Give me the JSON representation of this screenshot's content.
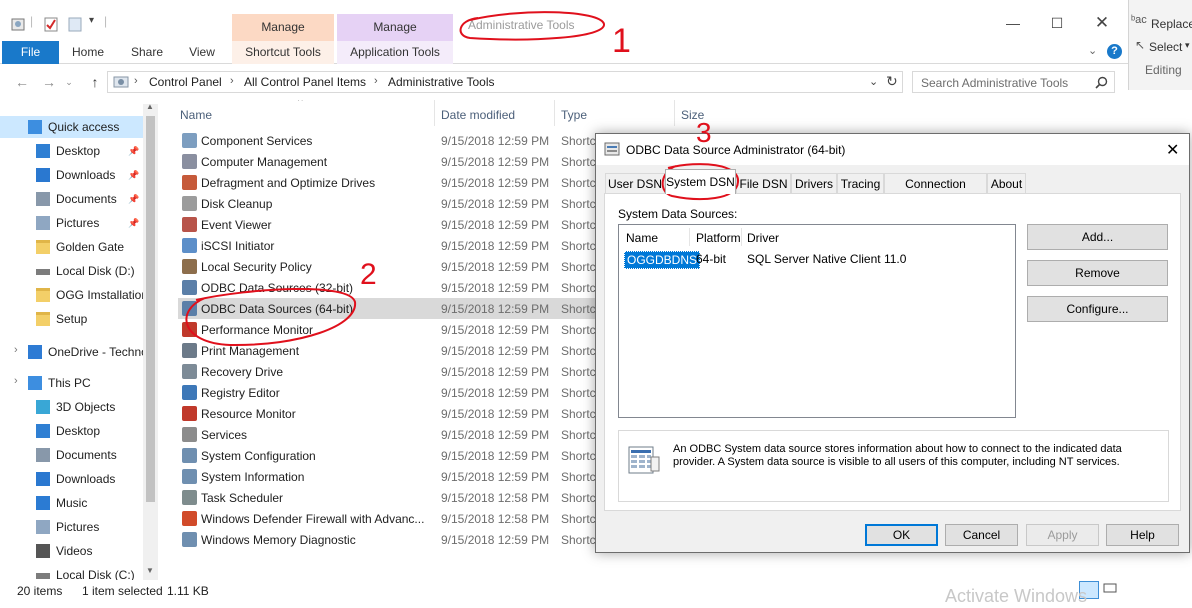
{
  "explorer": {
    "title": "Administrative Tools",
    "contextual_tabs": [
      {
        "group": "Manage",
        "label": "Shortcut Tools",
        "color": "#fcd9c4"
      },
      {
        "group": "Manage",
        "label": "Application Tools",
        "color": "#e6d2f5"
      }
    ],
    "ribbon_tabs": [
      "File",
      "Home",
      "Share",
      "View"
    ],
    "breadcrumb": [
      "Control Panel",
      "All Control Panel Items",
      "Administrative Tools"
    ],
    "search_placeholder": "Search Administrative Tools",
    "columns": [
      "Name",
      "Date modified",
      "Type",
      "Size"
    ],
    "nav": [
      {
        "label": "Quick access",
        "icon": "star-icon",
        "pinned": false
      },
      {
        "label": "Desktop",
        "icon": "desktop-icon",
        "pinned": true
      },
      {
        "label": "Downloads",
        "icon": "download-icon",
        "pinned": true
      },
      {
        "label": "Documents",
        "icon": "documents-icon",
        "pinned": true
      },
      {
        "label": "Pictures",
        "icon": "pictures-icon",
        "pinned": true
      },
      {
        "label": "Golden Gate",
        "icon": "folder-icon",
        "pinned": false
      },
      {
        "label": "Local Disk (D:)",
        "icon": "drive-icon",
        "pinned": false
      },
      {
        "label": "OGG Imstallation",
        "icon": "folder-icon",
        "pinned": false
      },
      {
        "label": "Setup",
        "icon": "folder-icon",
        "pinned": false
      },
      {
        "label": "OneDrive - Techno",
        "icon": "cloud-icon",
        "pinned": false
      },
      {
        "label": "This PC",
        "icon": "computer-icon",
        "pinned": false
      },
      {
        "label": "3D Objects",
        "icon": "cube-icon",
        "pinned": false
      },
      {
        "label": "Desktop",
        "icon": "desktop-icon",
        "pinned": false
      },
      {
        "label": "Documents",
        "icon": "documents-icon",
        "pinned": false
      },
      {
        "label": "Downloads",
        "icon": "download-icon",
        "pinned": false
      },
      {
        "label": "Music",
        "icon": "music-icon",
        "pinned": false
      },
      {
        "label": "Pictures",
        "icon": "pictures-icon",
        "pinned": false
      },
      {
        "label": "Videos",
        "icon": "videos-icon",
        "pinned": false
      },
      {
        "label": "Local Disk (C:)",
        "icon": "drive-icon",
        "pinned": false
      }
    ],
    "files": [
      {
        "name": "Component Services",
        "date": "9/15/2018 12:59 PM",
        "type": "Shortcut"
      },
      {
        "name": "Computer Management",
        "date": "9/15/2018 12:59 PM",
        "type": "Shortcut"
      },
      {
        "name": "Defragment and Optimize Drives",
        "date": "9/15/2018 12:59 PM",
        "type": "Shortcut"
      },
      {
        "name": "Disk Cleanup",
        "date": "9/15/2018 12:59 PM",
        "type": "Shortcut"
      },
      {
        "name": "Event Viewer",
        "date": "9/15/2018 12:59 PM",
        "type": "Shortcut"
      },
      {
        "name": "iSCSI Initiator",
        "date": "9/15/2018 12:59 PM",
        "type": "Shortcut"
      },
      {
        "name": "Local Security Policy",
        "date": "9/15/2018 12:59 PM",
        "type": "Shortcut"
      },
      {
        "name": "ODBC Data Sources (32-bit)",
        "date": "9/15/2018 12:59 PM",
        "type": "Shortcut"
      },
      {
        "name": "ODBC Data Sources (64-bit)",
        "date": "9/15/2018 12:59 PM",
        "type": "Shortcut",
        "selected": true
      },
      {
        "name": "Performance Monitor",
        "date": "9/15/2018 12:59 PM",
        "type": "Shortcut"
      },
      {
        "name": "Print Management",
        "date": "9/15/2018 12:59 PM",
        "type": "Shortcut"
      },
      {
        "name": "Recovery Drive",
        "date": "9/15/2018 12:59 PM",
        "type": "Shortcut"
      },
      {
        "name": "Registry Editor",
        "date": "9/15/2018 12:59 PM",
        "type": "Shortcut"
      },
      {
        "name": "Resource Monitor",
        "date": "9/15/2018 12:59 PM",
        "type": "Shortcut"
      },
      {
        "name": "Services",
        "date": "9/15/2018 12:59 PM",
        "type": "Shortcut"
      },
      {
        "name": "System Configuration",
        "date": "9/15/2018 12:59 PM",
        "type": "Shortcut"
      },
      {
        "name": "System Information",
        "date": "9/15/2018 12:59 PM",
        "type": "Shortcut"
      },
      {
        "name": "Task Scheduler",
        "date": "9/15/2018 12:58 PM",
        "type": "Shortcut"
      },
      {
        "name": "Windows Defender Firewall with Advanc...",
        "date": "9/15/2018 12:58 PM",
        "type": "Shortcut"
      },
      {
        "name": "Windows Memory Diagnostic",
        "date": "9/15/2018 12:59 PM",
        "type": "Shortcut"
      }
    ],
    "status": {
      "items": "20 items",
      "selected": "1 item selected",
      "size": "1.11 KB"
    }
  },
  "behind_window": {
    "replace": "Replace",
    "select": "Select",
    "editing": "Editing"
  },
  "odbc": {
    "title": "ODBC Data Source Administrator (64-bit)",
    "tabs": [
      "User DSN",
      "System DSN",
      "File DSN",
      "Drivers",
      "Tracing",
      "Connection Pooling",
      "About"
    ],
    "active_tab": "System DSN",
    "list_label": "System Data Sources:",
    "list_headers": [
      "Name",
      "Platform",
      "Driver"
    ],
    "rows": [
      {
        "name": "OGGDBDNS",
        "platform": "64-bit",
        "driver": "SQL Server Native Client 11.0"
      }
    ],
    "side_buttons": [
      "Add...",
      "Remove",
      "Configure..."
    ],
    "info_text": "An ODBC System data source stores information about how to connect to the indicated data provider.  A System data source is visible to all users of this computer, including NT services.",
    "bottom_buttons": [
      "OK",
      "Cancel",
      "Apply",
      "Help"
    ]
  },
  "watermark": "Activate Windows",
  "annotations": [
    "1",
    "2",
    "3"
  ],
  "colors": {
    "file_tab": "#1979ca",
    "selection": "#0078d7",
    "annotation": "#e0101c"
  }
}
